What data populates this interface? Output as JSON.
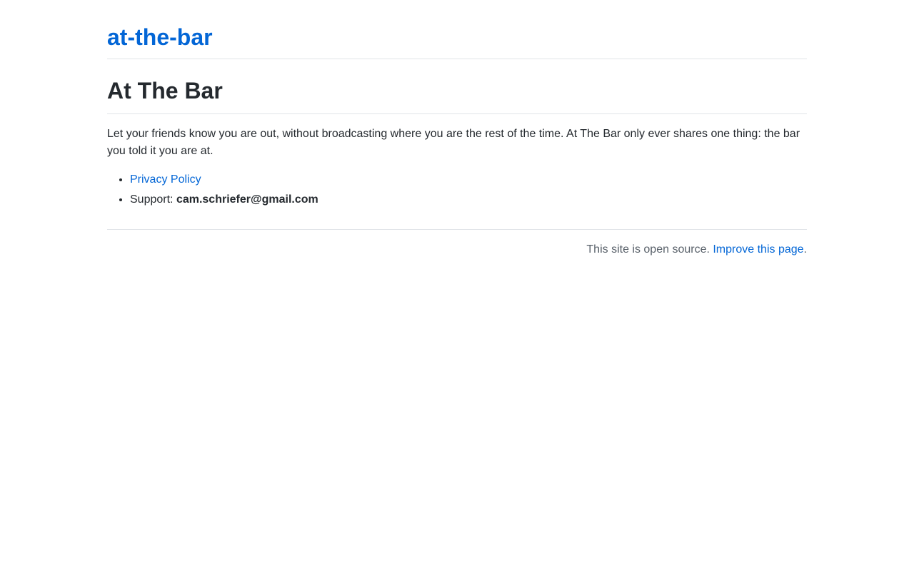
{
  "header": {
    "site_title": "at-the-bar"
  },
  "main": {
    "heading": "At The Bar",
    "description": "Let your friends know you are out, without broadcasting where you are the rest of the time. At The Bar only ever shares one thing: the bar you told it you are at.",
    "links": {
      "privacy_label": "Privacy Policy",
      "support_prefix": "Support: ",
      "support_email": "cam.schriefer@gmail.com"
    }
  },
  "footer": {
    "text": "This site is open source. ",
    "improve_label": "Improve this page",
    "suffix": "."
  },
  "colors": {
    "link": "#0366d6",
    "text": "#24292e",
    "muted": "#586069",
    "divider": "#e1e4e8"
  }
}
